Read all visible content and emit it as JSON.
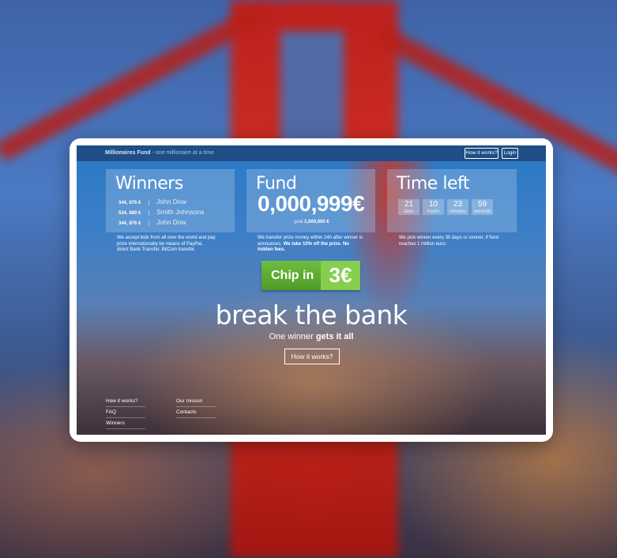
{
  "brand": {
    "name": "Millionaires Fund",
    "tagline": "- one millionaire at a time"
  },
  "nav": {
    "how_it_works": "How it works?",
    "login": "Login"
  },
  "winners": {
    "title": "Winners",
    "rows": [
      {
        "amount": "344, 876 €",
        "separator": "|",
        "name": "John Dow"
      },
      {
        "amount": "534, 889 €",
        "separator": "|",
        "name": "Smith Johnsons"
      },
      {
        "amount": "344, 876 €",
        "separator": "|",
        "name": "John Dow"
      }
    ],
    "text": "We accept bids from all over the world and pay prize internationally be means of PayPal, direct Bank Transfer, BitCoin transfer."
  },
  "fund": {
    "title": "Fund",
    "amount": "0,000,999€",
    "goal_label": "goal",
    "goal_value": "1,000,000 €",
    "text_pre": "We transfer prize money within 24h after winner is announces.",
    "text_bold": "We take 10% off the prize. No hidden fees."
  },
  "time_left": {
    "title": "Time left",
    "units": [
      {
        "value": "21",
        "label": "days"
      },
      {
        "value": "10",
        "label": "hours"
      },
      {
        "value": "23",
        "label": "minutes"
      },
      {
        "value": "59",
        "label": "seconds"
      }
    ],
    "text": "We pick winner every 30 days or sooner, if fund reaches 1 million euro."
  },
  "chip_in": {
    "label": "Chip in",
    "price": "3€"
  },
  "hero": {
    "headline": "break the bank",
    "sub_pre": "One winner",
    "sub_bold": "gets it all",
    "cta": "How it works?"
  },
  "footer": {
    "col1": [
      "How it works?",
      "FAQ",
      "Winners"
    ],
    "col2": [
      "Our misson",
      "Contacts"
    ]
  }
}
